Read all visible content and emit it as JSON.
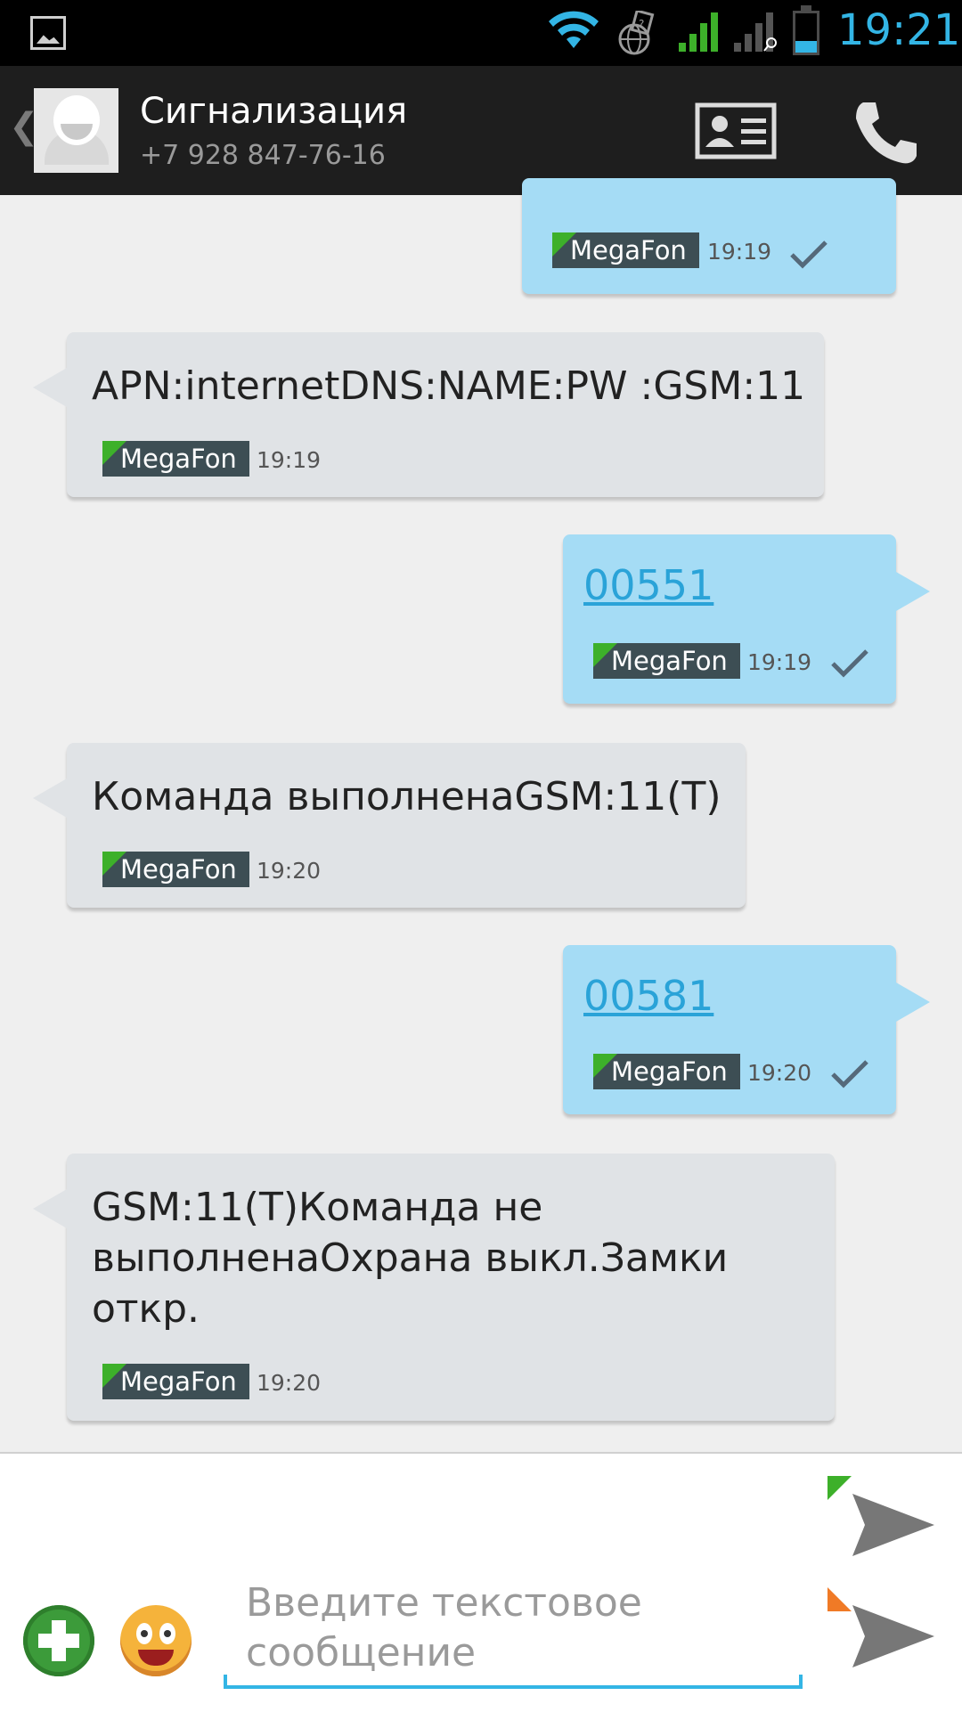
{
  "status_bar": {
    "time": "19:21",
    "battery_percent": 30
  },
  "header": {
    "contact_name": "Сигнализация",
    "phone": "+7 928 847-76-16"
  },
  "messages": [
    {
      "direction": "out",
      "text": "",
      "operator": "MegaFon",
      "time": "19:19",
      "delivered": true
    },
    {
      "direction": "in",
      "text": "APN:internetDNS:NAME:PW :GSM:11",
      "operator": "MegaFon",
      "time": "19:19"
    },
    {
      "direction": "out",
      "text": "00551",
      "operator": "MegaFon",
      "time": "19:19",
      "delivered": true
    },
    {
      "direction": "in",
      "text": "Команда выполненаGSM:11(T)",
      "operator": "MegaFon",
      "time": "19:20"
    },
    {
      "direction": "out",
      "text": "00581",
      "operator": "MegaFon",
      "time": "19:20",
      "delivered": true
    },
    {
      "direction": "in",
      "text": "GSM:11(T)Команда не\nвыполненаОхрана выкл.Замки\nоткр.",
      "operator": "MegaFon",
      "time": "19:20"
    }
  ],
  "compose": {
    "placeholder": "Введите текстовое\nсообщение",
    "send_sim1_color": "#3db02a",
    "send_sim2_color": "#f07a26"
  },
  "colors": {
    "accent": "#33b5e5",
    "incoming": "#e0e3e6",
    "outgoing": "#a5dcf5"
  }
}
